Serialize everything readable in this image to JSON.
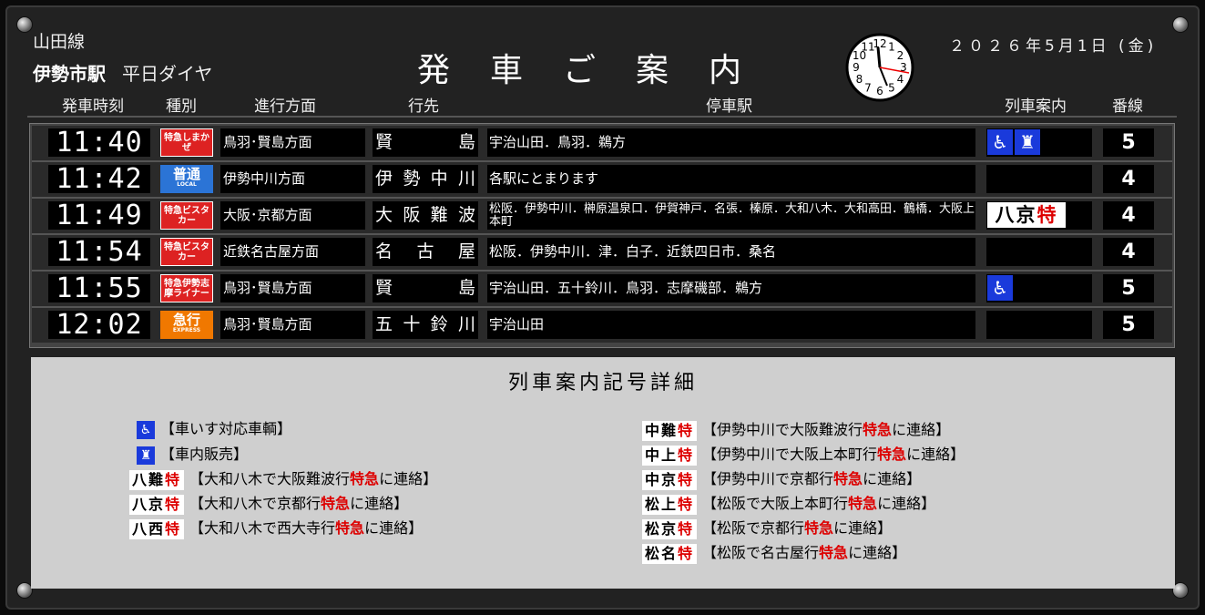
{
  "header": {
    "line_name": "山田線",
    "station": "伊勢市駅",
    "diagram": "平日ダイヤ",
    "title": "発車ご案内",
    "date": "２０２６年5月1日 (金)",
    "clock_numbers": [
      "12",
      "1",
      "2",
      "3",
      "4",
      "5",
      "6",
      "7",
      "8",
      "9",
      "10",
      "11"
    ]
  },
  "columns": {
    "time": "発車時刻",
    "type": "種別",
    "direction": "進行方面",
    "destination": "行先",
    "stops": "停車駅",
    "info": "列車案内",
    "track": "番線"
  },
  "rows": [
    {
      "time": "11:40",
      "type": "特急しまかぜ",
      "direction": "鳥羽･賢島方面",
      "destination": "賢島",
      "stops": "宇治山田．鳥羽．鵜方",
      "info": "wheelchair+shop",
      "track": "5"
    },
    {
      "time": "11:42",
      "type": "普通",
      "type_sub": "LOCAL",
      "direction": "伊勢中川方面",
      "destination": "伊勢中川",
      "stops": "各駅にとまります",
      "info": "",
      "track": "4"
    },
    {
      "time": "11:49",
      "type": "特急ビスタカー",
      "direction": "大阪･京都方面",
      "destination": "大阪難波",
      "stops": "松阪．伊勢中川．榊原温泉口．伊賀神戸．名張．榛原．大和八木．大和高田．鶴橋．大阪上本町",
      "info": "八京特",
      "track": "4"
    },
    {
      "time": "11:54",
      "type": "特急ビスタカー",
      "direction": "近鉄名古屋方面",
      "destination": "名古屋",
      "stops": "松阪．伊勢中川．津．白子．近鉄四日市．桑名",
      "info": "",
      "track": "4"
    },
    {
      "time": "11:55",
      "type": "特急伊勢志摩ライナー",
      "direction": "鳥羽･賢島方面",
      "destination": "賢島",
      "stops": "宇治山田．五十鈴川．鳥羽．志摩磯部．鵜方",
      "info": "wheelchair",
      "track": "5"
    },
    {
      "time": "12:02",
      "type": "急行",
      "type_sub": "EXPRESS",
      "direction": "鳥羽･賢島方面",
      "destination": "五十鈴川",
      "stops": "宇治山田",
      "info": "",
      "track": "5"
    }
  ],
  "legend": {
    "title": "列車案内記号詳細",
    "left": [
      {
        "symbol": "wheelchair-icon",
        "text": "【車いす対応車輌】"
      },
      {
        "symbol": "shop-icon",
        "text": "【車内販売】"
      },
      {
        "code": "八難",
        "pre": "【大和八木で大阪難波行",
        "post": "に連絡】"
      },
      {
        "code": "八京",
        "pre": "【大和八木で京都行",
        "post": "に連絡】"
      },
      {
        "code": "八西",
        "pre": "【大和八木で西大寺行",
        "post": "に連絡】"
      }
    ],
    "right": [
      {
        "code": "中難",
        "pre": "【伊勢中川で大阪難波行",
        "post": "に連絡】"
      },
      {
        "code": "中上",
        "pre": "【伊勢中川で大阪上本町行",
        "post": "に連絡】"
      },
      {
        "code": "中京",
        "pre": "【伊勢中川で京都行",
        "post": "に連絡】"
      },
      {
        "code": "松上",
        "pre": "【松阪で大阪上本町行",
        "post": "に連絡】"
      },
      {
        "code": "松京",
        "pre": "【松阪で京都行",
        "post": "に連絡】"
      },
      {
        "code": "松名",
        "pre": "【松阪で名古屋行",
        "post": "に連絡】"
      }
    ],
    "tokkyu_mark": "特",
    "tokkyu_word": "特急"
  },
  "colors": {
    "wheelchair_blue": "#1a3adb",
    "local_blue": "#2b74d6",
    "express_orange": "#f07800",
    "limited_red": "#d22"
  }
}
